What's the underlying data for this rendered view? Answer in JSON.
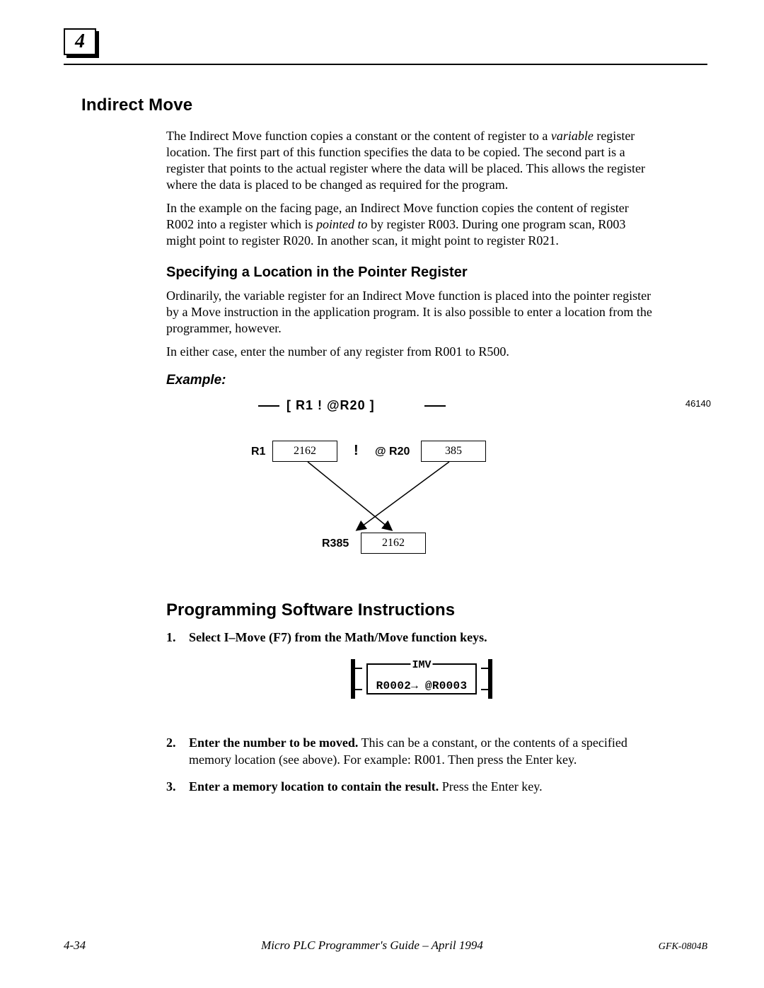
{
  "chapter_number": "4",
  "section_title": "Indirect Move",
  "paragraphs": {
    "p1a": "The Indirect Move function copies a constant or the content of register to a ",
    "p1_var": "variable",
    "p1b": " register location. The first part of this function specifies the data to be copied. The second part is a register that points to the actual register where the data will be placed. This allows the register where the data is placed to be changed as required for the program.",
    "p2a": "In the example on the facing  page, an Indirect Move function copies the content of register R002 into a register which is ",
    "p2_var": "pointed to",
    "p2b": " by register R003. During one program scan, R003 might point to register R020. In another scan, it might point to register R021."
  },
  "subheading": "Specifying a Location in the Pointer Register",
  "sub_p1": "Ordinarily, the variable register for an Indirect Move function is placed into the pointer register by a Move instruction in the application program. It is also possible to enter a location from the programmer, however.",
  "sub_p2": "In either case, enter the number of any register from R001 to R500.",
  "example_label": "Example:",
  "diagram": {
    "top_expr": "[  R1  !   @R20    ]",
    "figure_no": "46140",
    "r1_label": "R1",
    "r1_value": "2162",
    "bang": "!",
    "at_label": "@ R20",
    "at_value": "385",
    "r385_label": "R385",
    "r385_value": "2162"
  },
  "section2_title": "Programming Software Instructions",
  "steps": {
    "s1_num": "1.",
    "s1_lead": "Select   I–Move  (F7)  from the Math/Move function keys.",
    "s2_num": "2.",
    "s2_lead": "Enter the number to be moved.",
    "s2_rest": " This can be a constant, or the contents of a specified memory location (see above). For example: R001. Then press the Enter key.",
    "s3_num": "3.",
    "s3_lead": "Enter a memory location to contain the result.",
    "s3_rest": "  Press the Enter key."
  },
  "fn_block": {
    "title": "IMV",
    "content": "R0002→ @R0003"
  },
  "footer": {
    "page": "4-34",
    "center": "Micro PLC Programmer's Guide – April 1994",
    "doc": "GFK-0804B"
  }
}
